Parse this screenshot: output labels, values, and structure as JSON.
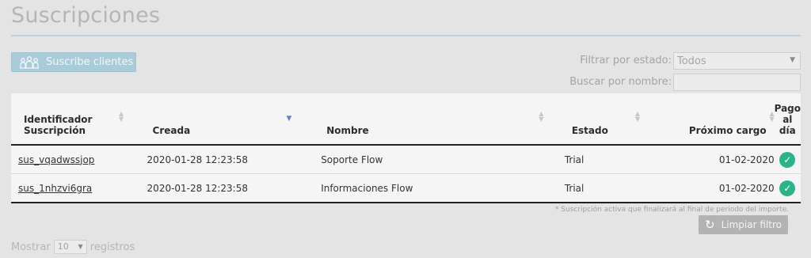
{
  "page": {
    "title": "Suscripciones"
  },
  "toolbar": {
    "subscribe_label": "Suscribe clientes"
  },
  "filters": {
    "state_label": "Filtrar por estado:",
    "state_value": "Todos",
    "search_label": "Buscar por nombre:",
    "search_value": ""
  },
  "table": {
    "columns": [
      {
        "label": "Identificador Suscripción",
        "line1": "Identificador",
        "line2": "Suscripción"
      },
      {
        "label": "Creada"
      },
      {
        "label": "Nombre"
      },
      {
        "label": "Estado"
      },
      {
        "label": "Próximo cargo"
      },
      {
        "label": "Pago al día"
      }
    ],
    "rows": [
      {
        "id": "sus_vqadwssjop",
        "created": "2020-01-28 12:23:58",
        "name": "Soporte Flow",
        "state": "Trial",
        "next_charge": "01-02-2020",
        "paid": true
      },
      {
        "id": "sus_1nhzvi6gra",
        "created": "2020-01-28 12:23:58",
        "name": "Informaciones Flow",
        "state": "Trial",
        "next_charge": "01-02-2020",
        "paid": true
      }
    ]
  },
  "footnote": "* Suscripción activa que finalizará al final de periodo del importe.",
  "clear_filter_label": "Limpiar filtro",
  "pagination": {
    "show_label": "Mostrar",
    "page_size": "10",
    "records_label": "registros"
  },
  "colors": {
    "accent": "#a9ccd8",
    "paid_check": "#2db38a"
  }
}
